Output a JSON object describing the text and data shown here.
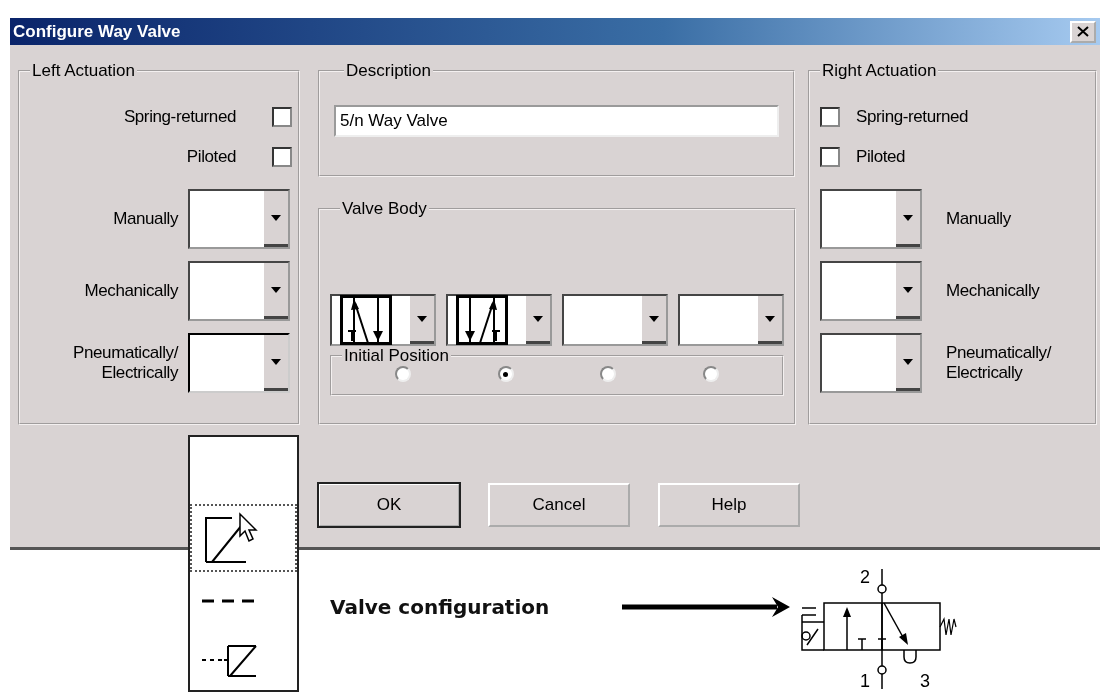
{
  "window": {
    "title": "Configure Way Valve"
  },
  "left_actuation": {
    "title": "Left Actuation",
    "checkboxes": [
      {
        "label": "Spring-returned",
        "checked": false
      },
      {
        "label": "Piloted",
        "checked": false
      }
    ],
    "dropdowns": [
      {
        "label": "Manually",
        "open": false
      },
      {
        "label": "Mechanically",
        "open": false
      },
      {
        "label": "Pneumatically/ Electrically",
        "open": true
      }
    ]
  },
  "description": {
    "title": "Description",
    "value": "5/n Way Valve"
  },
  "valve_body": {
    "title": "Valve Body",
    "positions": [
      {
        "kind": "cross-up-left"
      },
      {
        "kind": "cross-up-right"
      },
      {
        "kind": "empty"
      },
      {
        "kind": "empty"
      }
    ],
    "initial_position": {
      "title": "Initial Position",
      "options": [
        {
          "selected": false
        },
        {
          "selected": true
        },
        {
          "selected": false
        },
        {
          "selected": false
        }
      ]
    }
  },
  "right_actuation": {
    "title": "Right Actuation",
    "checkboxes": [
      {
        "label": "Spring-returned",
        "checked": false
      },
      {
        "label": "Piloted",
        "checked": false
      }
    ],
    "dropdowns": [
      {
        "label": "Manually",
        "open": false
      },
      {
        "label": "Mechanically",
        "open": false
      },
      {
        "label": "Pneumatically/ Electrically",
        "open": false
      }
    ]
  },
  "buttons": [
    {
      "label": "OK",
      "default": true
    },
    {
      "label": "Cancel",
      "default": false
    },
    {
      "label": "Help",
      "default": false
    }
  ],
  "dropdown_list": {
    "items": [
      {
        "kind": "blank",
        "selected": false
      },
      {
        "kind": "lever",
        "selected": true
      },
      {
        "kind": "dashed",
        "selected": false
      },
      {
        "kind": "pilot",
        "selected": false
      }
    ]
  },
  "annotation": {
    "label": "Valve configuration",
    "ports": [
      "2",
      "1",
      "3"
    ]
  }
}
